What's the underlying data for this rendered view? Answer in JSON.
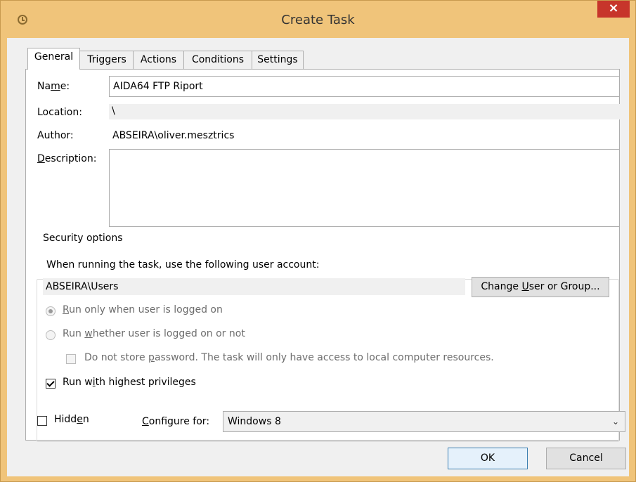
{
  "window": {
    "title": "Create Task",
    "close_label": "×"
  },
  "tabs": [
    {
      "label": "General",
      "active": true
    },
    {
      "label": "Triggers"
    },
    {
      "label": "Actions"
    },
    {
      "label": "Conditions"
    },
    {
      "label": "Settings"
    }
  ],
  "general": {
    "name_label_pre": "Na",
    "name_label_ul": "m",
    "name_label_post": "e:",
    "name_value": "AIDA64 FTP Riport",
    "location_label": "Location:",
    "location_value": "\\",
    "author_label": "Author:",
    "author_value": "ABSEIRA\\oliver.mesztrics",
    "description_label_ul": "D",
    "description_label_post": "escription:",
    "description_value": ""
  },
  "security": {
    "group_title": "Security options",
    "account_prompt": "When running the task, use the following user account:",
    "account_value": "ABSEIRA\\Users",
    "change_btn_pre": "Change ",
    "change_btn_ul": "U",
    "change_btn_post": "ser or Group...",
    "radio_logged_on_ul": "R",
    "radio_logged_on_post": "un only when user is logged on",
    "radio_whether_pre": "Run ",
    "radio_whether_ul": "w",
    "radio_whether_post": "hether user is logged on or not",
    "no_store_pre": "Do not store ",
    "no_store_ul": "p",
    "no_store_post": "assword.  The task will only have access to local computer resources.",
    "highest_pre": "Run w",
    "highest_ul": "i",
    "highest_post": "th highest privileges",
    "highest_checked": true
  },
  "footer": {
    "hidden_pre": "Hidd",
    "hidden_ul": "e",
    "hidden_post": "n",
    "configure_ul": "C",
    "configure_post": "onfigure for:",
    "configure_value": "Windows 8",
    "ok_label": "OK",
    "cancel_label": "Cancel"
  }
}
